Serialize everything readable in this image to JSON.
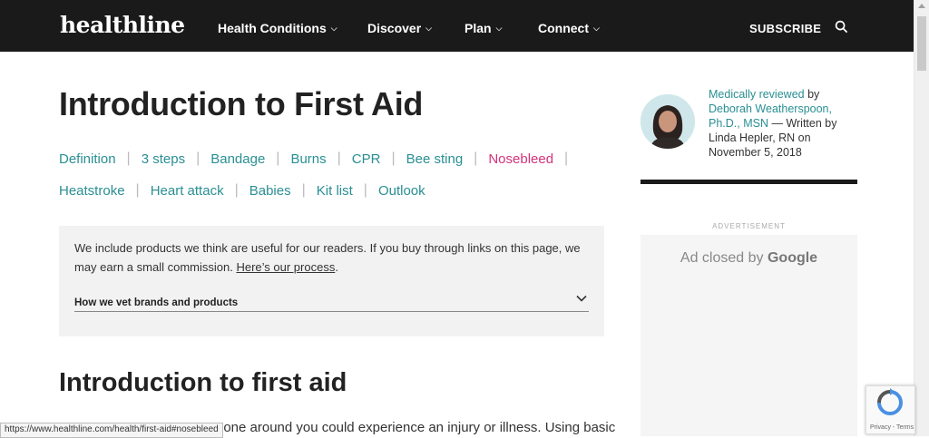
{
  "brand": {
    "logo": "healthline"
  },
  "nav": {
    "items": [
      {
        "label": "Health Conditions"
      },
      {
        "label": "Discover"
      },
      {
        "label": "Plan"
      },
      {
        "label": "Connect"
      }
    ],
    "subscribe": "SUBSCRIBE"
  },
  "article": {
    "title": "Introduction to First Aid",
    "toc_row1": [
      "Definition",
      "3 steps",
      "Bandage",
      "Burns",
      "CPR",
      "Bee sting",
      "Nosebleed"
    ],
    "toc_row2": [
      "Heatstroke",
      "Heart attack",
      "Babies",
      "Kit list",
      "Outlook"
    ],
    "active_toc": "Nosebleed",
    "disclosure": {
      "text": "We include products we think are useful for our readers. If you buy through links on this page, we may earn a small commission.",
      "link": "Here’s our process",
      "after_link": ".",
      "vet_label": "How we vet brands and products"
    },
    "section_heading": "Introduction to first aid",
    "body_snippet": "eone around you could experience an injury or illness. Using basic"
  },
  "sidebar": {
    "reviewed_link": "Medically reviewed",
    "reviewed_by": " by ",
    "reviewer": "Deborah Weatherspoon, Ph.D., MSN",
    "written_by": " — Written by Linda Hepler, RN on November 5, 2018",
    "ad_label": "ADVERTISEMENT",
    "ad_closed": "Ad closed by",
    "ad_google": "Google"
  },
  "status_url": "https://www.healthline.com/health/first-aid#nosebleed",
  "recaptcha_terms": "Privacy - Terms",
  "colors": {
    "accent": "#2a8f93",
    "active": "#d4337a",
    "nav_bg": "#1a1a1a"
  }
}
